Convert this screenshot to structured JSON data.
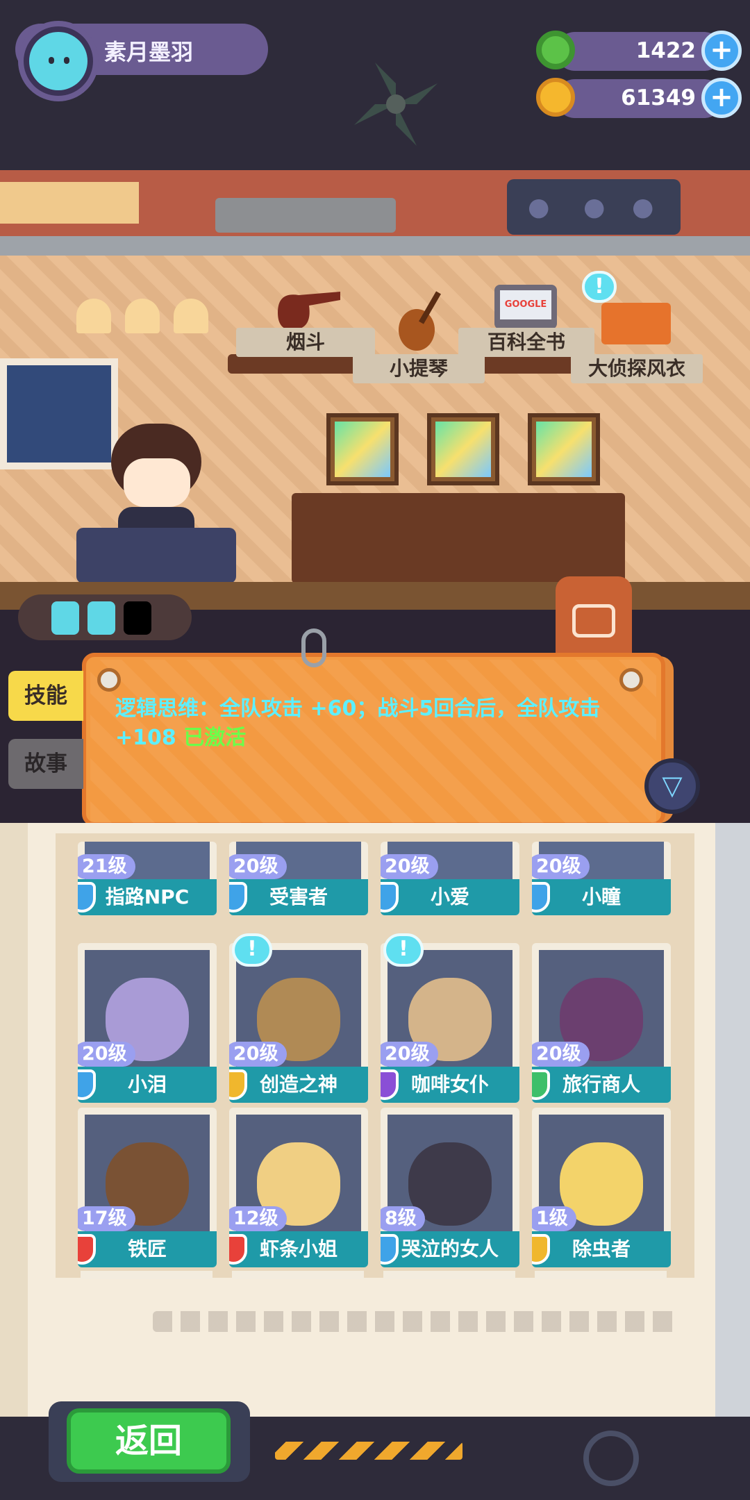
{
  "player": {
    "name": "素月墨羽",
    "avatar_icon": "cat-face-icon"
  },
  "currencies": [
    {
      "name": "donut",
      "value": "1422",
      "icon": "donut-coin-icon",
      "color": "#5cc248"
    },
    {
      "name": "planet",
      "value": "61349",
      "icon": "planet-coin-icon",
      "color": "#f5b72d"
    }
  ],
  "room": {
    "items": [
      {
        "label": "烟斗",
        "icon": "pipe-icon"
      },
      {
        "label": "小提琴",
        "icon": "violin-icon"
      },
      {
        "label": "百科全书",
        "icon": "encyclopedia-icon",
        "brand": "GOOGLE"
      },
      {
        "label": "大侦探风衣",
        "icon": "trench-coat-icon"
      }
    ],
    "energy": {
      "filled": 2,
      "total": 3
    }
  },
  "tabs": {
    "skill": "技能",
    "story": "故事"
  },
  "skill": {
    "text": "逻辑思维：全队攻击 +60；战斗5回合后，全队攻击 +108",
    "status": "已激活"
  },
  "characters_top": [
    {
      "level": "21级",
      "name": "指路NPC",
      "shield_color": "#3fa3e8"
    },
    {
      "level": "20级",
      "name": "受害者",
      "shield_color": "#3fa3e8"
    },
    {
      "level": "20级",
      "name": "小爱",
      "shield_color": "#3fa3e8"
    },
    {
      "level": "20级",
      "name": "小瞳",
      "shield_color": "#3fa3e8"
    }
  ],
  "characters": [
    {
      "level": "20级",
      "name": "小泪",
      "shield_color": "#3fa3e8",
      "portrait_color": "#a99bd6",
      "alert": false
    },
    {
      "level": "20级",
      "name": "创造之神",
      "shield_color": "#f0b72d",
      "portrait_color": "#b08a55",
      "alert": true
    },
    {
      "level": "20级",
      "name": "咖啡女仆",
      "shield_color": "#8a4fd6",
      "portrait_color": "#d4b48a",
      "alert": true
    },
    {
      "level": "20级",
      "name": "旅行商人",
      "shield_color": "#3dbf6a",
      "portrait_color": "#6b3f6f",
      "alert": false
    },
    {
      "level": "17级",
      "name": "铁匠",
      "shield_color": "#e8413a",
      "portrait_color": "#7a5234",
      "alert": false
    },
    {
      "level": "12级",
      "name": "虾条小姐",
      "shield_color": "#e8413a",
      "portrait_color": "#f0cf83",
      "alert": false
    },
    {
      "level": "8级",
      "name": "哭泣的女人",
      "shield_color": "#3fa3e8",
      "portrait_color": "#3e3a4a",
      "alert": false
    },
    {
      "level": "1级",
      "name": "除虫者",
      "shield_color": "#f0b72d",
      "portrait_color": "#f3d36a",
      "alert": false
    }
  ],
  "buttons": {
    "back": "返回"
  },
  "alert_glyph": "!",
  "filter_glyph": "▽"
}
